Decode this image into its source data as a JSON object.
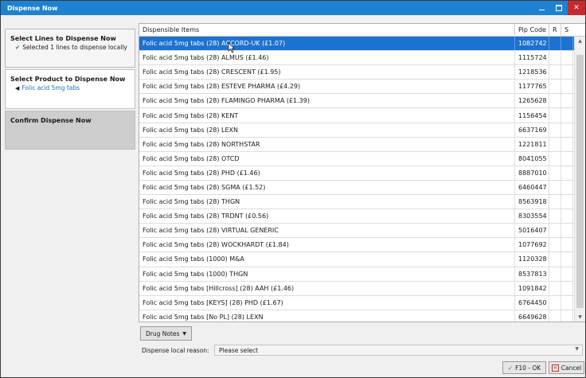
{
  "window": {
    "title": "Dispense Now",
    "close_label": "✕"
  },
  "sidebar": {
    "steps": [
      {
        "title": "Select Lines to Dispense Now",
        "subtitle": "Selected 1 lines to dispense locally"
      },
      {
        "title": "Select Product to Dispense Now",
        "subtitle": "Folic acid 5mg tabs"
      },
      {
        "title": "Confirm Dispense Now"
      }
    ]
  },
  "table": {
    "headers": {
      "item": "Dispensible Items",
      "pip": "Pip Code",
      "r": "R",
      "s": "S"
    },
    "rows": [
      {
        "item": "Folic acid 5mg tabs (28) ACCORD-UK (£1.07)",
        "pip": "1082742"
      },
      {
        "item": "Folic acid 5mg tabs (28) ALMUS (£1.46)",
        "pip": "1115724"
      },
      {
        "item": "Folic acid 5mg tabs (28) CRESCENT (£1.95)",
        "pip": "1218536"
      },
      {
        "item": "Folic acid 5mg tabs (28) ESTEVE PHARMA (£4.29)",
        "pip": "1177765"
      },
      {
        "item": "Folic acid 5mg tabs (28) FLAMINGO PHARMA (£1.39)",
        "pip": "1265628"
      },
      {
        "item": "Folic acid 5mg tabs (28) KENT",
        "pip": "1156454"
      },
      {
        "item": "Folic acid 5mg tabs (28) LEXN",
        "pip": "6637169"
      },
      {
        "item": "Folic acid 5mg tabs (28) NORTHSTAR",
        "pip": "1221811"
      },
      {
        "item": "Folic acid 5mg tabs (28) OTCD",
        "pip": "8041055"
      },
      {
        "item": "Folic acid 5mg tabs (28) PHD (£1.46)",
        "pip": "8887010"
      },
      {
        "item": "Folic acid 5mg tabs (28) SGMA (£1.52)",
        "pip": "6460447"
      },
      {
        "item": "Folic acid 5mg tabs (28) THGN",
        "pip": "8563918"
      },
      {
        "item": "Folic acid 5mg tabs (28) TRDNT (£0.56)",
        "pip": "8303554"
      },
      {
        "item": "Folic acid 5mg tabs (28) VIRTUAL GENERIC",
        "pip": "5016407"
      },
      {
        "item": "Folic acid 5mg tabs (28) WOCKHARDT (£1.84)",
        "pip": "1077692"
      },
      {
        "item": "Folic acid 5mg tabs (1000) M&A",
        "pip": "1120328"
      },
      {
        "item": "Folic acid 5mg tabs (1000) THGN",
        "pip": "8537813"
      },
      {
        "item": "Folic acid 5mg tabs [Hillcross] (28) AAH (£1.46)",
        "pip": "1091842"
      },
      {
        "item": "Folic acid 5mg tabs [KEYS] (28) PHD (£1.67)",
        "pip": "6764450"
      },
      {
        "item": "Folic acid 5mg tabs [No PL] (28) LEXN",
        "pip": "6649628"
      }
    ],
    "selected_index": 0
  },
  "footer": {
    "drug_notes_label": "Drug Notes",
    "reason_label": "Dispense local reason:",
    "reason_value": "Please select",
    "ok_label": "F10 - OK",
    "cancel_label": "Cancel"
  },
  "colors": {
    "titlebar": "#1e82d2",
    "selection": "#1e72cf",
    "close": "#c9282d"
  }
}
